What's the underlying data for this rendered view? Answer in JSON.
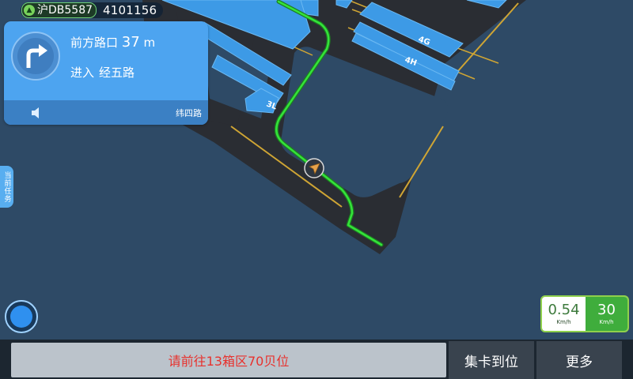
{
  "vehicle": {
    "plate": "沪DB5587",
    "id": "4101156"
  },
  "navigation": {
    "distance_prefix": "前方路口",
    "distance_value": "37",
    "distance_unit": "m",
    "enter_label": "进入",
    "next_road": "经五路",
    "current_road": "纬四路",
    "turn_icon": "turn-right-icon"
  },
  "map": {
    "bay_labels": [
      "4G",
      "4H",
      "3L"
    ]
  },
  "side_tab": {
    "label": "当前任务"
  },
  "speed": {
    "current": "0.54",
    "limit": "30",
    "unit": "Km/h"
  },
  "bottom": {
    "message": "请前往13箱区70贝位",
    "arrive_label": "集卡到位",
    "more_label": "更多"
  },
  "colors": {
    "background": "#2e4a66",
    "road": "#2a2d33",
    "container": "#3d9ae6",
    "route": "#34e33a",
    "nav_card": "#4da4f0",
    "message_text": "#e8312d",
    "speed_limit": "#3fad3c"
  }
}
